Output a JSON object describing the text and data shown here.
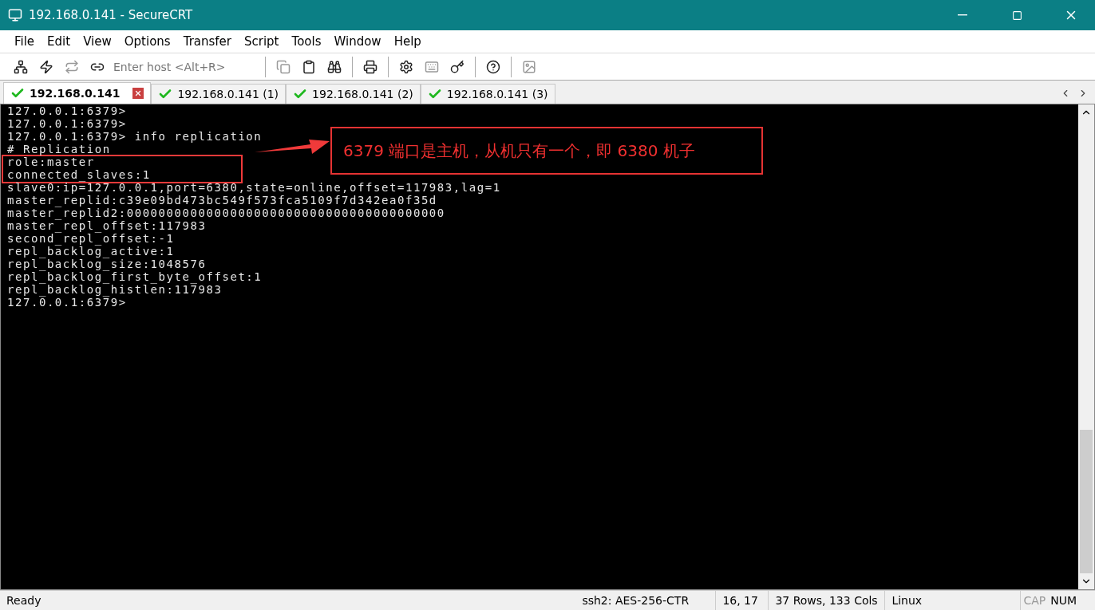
{
  "window": {
    "title": "192.168.0.141 - SecureCRT"
  },
  "menu": [
    "File",
    "Edit",
    "View",
    "Options",
    "Transfer",
    "Script",
    "Tools",
    "Window",
    "Help"
  ],
  "toolbar": {
    "host_field": {
      "placeholder": "Enter host <Alt+R>"
    }
  },
  "tabs": [
    {
      "label": "192.168.0.141",
      "selected": true
    },
    {
      "label": "192.168.0.141 (1)",
      "selected": false
    },
    {
      "label": "192.168.0.141 (2)",
      "selected": false
    },
    {
      "label": "192.168.0.141 (3)",
      "selected": false
    }
  ],
  "terminal": {
    "lines": [
      "127.0.0.1:6379>",
      "127.0.0.1:6379>",
      "127.0.0.1:6379> info replication",
      "# Replication",
      "role:master",
      "connected_slaves:1",
      "slave0:ip=127.0.0.1,port=6380,state=online,offset=117983,lag=1",
      "master_replid:c39e09bd473bc549f573fca5109f7d342ea0f35d",
      "master_replid2:0000000000000000000000000000000000000000",
      "master_repl_offset:117983",
      "second_repl_offset:-1",
      "repl_backlog_active:1",
      "repl_backlog_size:1048576",
      "repl_backlog_first_byte_offset:1",
      "repl_backlog_histlen:117983",
      "127.0.0.1:6379>"
    ]
  },
  "annotation": {
    "text": "6379 端口是主机，从机只有一个，即 6380 机子"
  },
  "status_bar": {
    "status": "Ready",
    "cipher": "ssh2: AES-256-CTR",
    "position": "16,  17",
    "size": "37 Rows, 133 Cols",
    "os": "Linux",
    "indicators": [
      {
        "label": "CAP",
        "on": false
      },
      {
        "label": "NUM",
        "on": true
      }
    ]
  }
}
